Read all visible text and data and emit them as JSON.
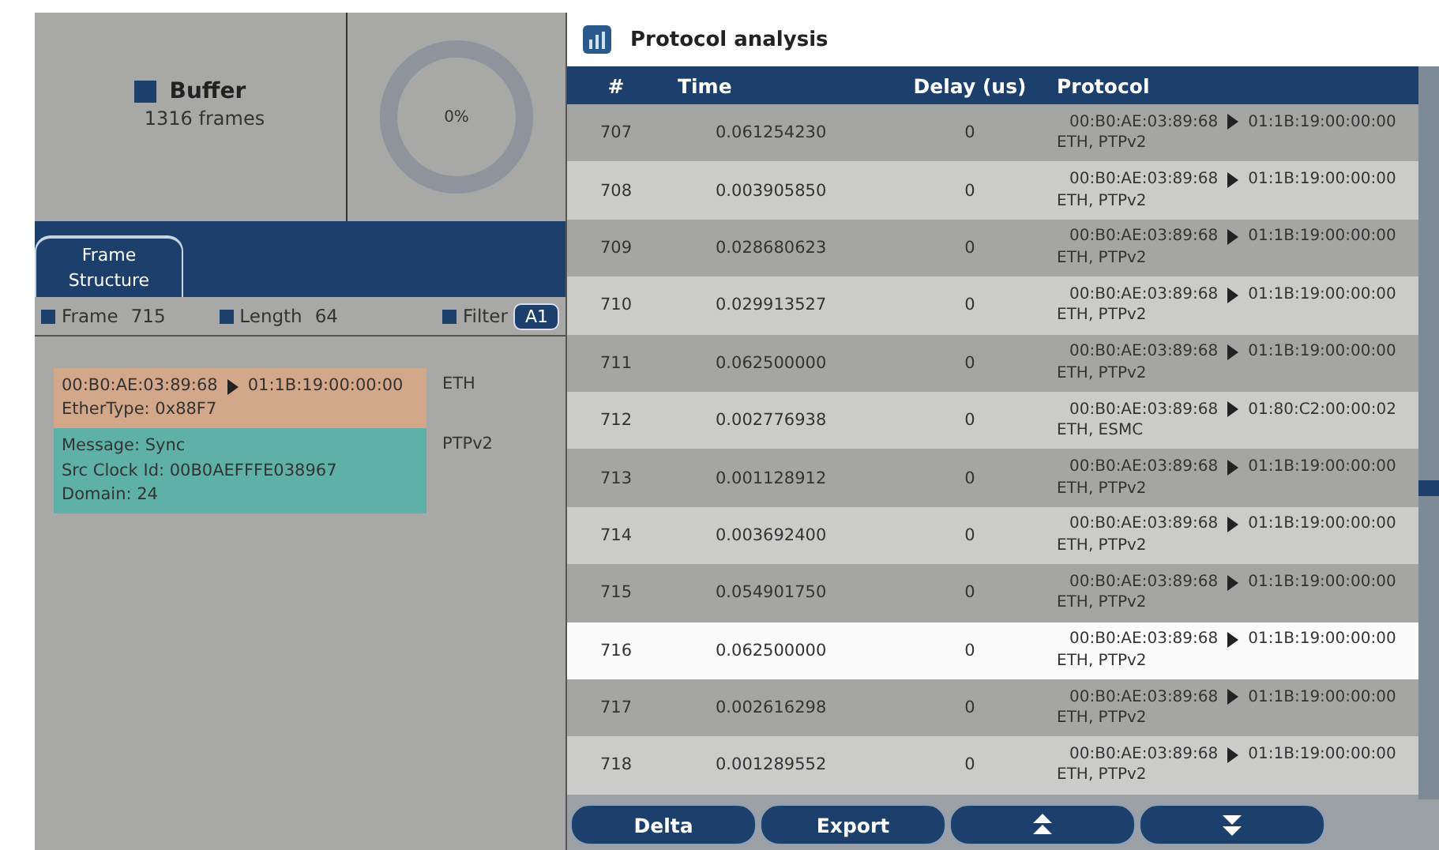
{
  "buffer": {
    "title": "Buffer",
    "frames": "1316 frames",
    "gauge": {
      "label": "0%",
      "level": 0
    }
  },
  "tabs": [
    {
      "label": "Frame Structure",
      "selected": true
    }
  ],
  "info": [
    {
      "label": "Frame",
      "value": "715"
    },
    {
      "label": "Length",
      "value": "64"
    },
    {
      "label": "Filter",
      "badge": "A1"
    }
  ],
  "layers": [
    {
      "color": "#d2a78a",
      "src": "00:B0:AE:03:89:68",
      "dst": "01:1B:19:00:00:00",
      "lines": [
        "EtherType: 0x88F7"
      ],
      "protocol": "ETH"
    },
    {
      "color": "#5fb0a6",
      "lines": [
        "Message: Sync",
        "Src Clock Id: 00B0AEFFFE038967",
        "Domain: 24"
      ],
      "protocol": "PTPv2"
    }
  ],
  "window": {
    "title": "Protocol analysis"
  },
  "table": {
    "columns": [
      "#",
      "Time",
      "Delay (us)",
      "Protocol"
    ],
    "rows": [
      {
        "num": "707",
        "time": "0.061254230",
        "delay": "0",
        "src": "00:B0:AE:03:89:68",
        "dst": "01:1B:19:00:00:00",
        "proto": "ETH, PTPv2",
        "selected": false
      },
      {
        "num": "708",
        "time": "0.003905850",
        "delay": "0",
        "src": "00:B0:AE:03:89:68",
        "dst": "01:1B:19:00:00:00",
        "proto": "ETH, PTPv2",
        "selected": false
      },
      {
        "num": "709",
        "time": "0.028680623",
        "delay": "0",
        "src": "00:B0:AE:03:89:68",
        "dst": "01:1B:19:00:00:00",
        "proto": "ETH, PTPv2",
        "selected": false
      },
      {
        "num": "710",
        "time": "0.029913527",
        "delay": "0",
        "src": "00:B0:AE:03:89:68",
        "dst": "01:1B:19:00:00:00",
        "proto": "ETH, PTPv2",
        "selected": false
      },
      {
        "num": "711",
        "time": "0.062500000",
        "delay": "0",
        "src": "00:B0:AE:03:89:68",
        "dst": "01:1B:19:00:00:00",
        "proto": "ETH, PTPv2",
        "selected": false
      },
      {
        "num": "712",
        "time": "0.002776938",
        "delay": "0",
        "src": "00:B0:AE:03:89:68",
        "dst": "01:80:C2:00:00:02",
        "proto": "ETH, ESMC",
        "selected": false
      },
      {
        "num": "713",
        "time": "0.001128912",
        "delay": "0",
        "src": "00:B0:AE:03:89:68",
        "dst": "01:1B:19:00:00:00",
        "proto": "ETH, PTPv2",
        "selected": false
      },
      {
        "num": "714",
        "time": "0.003692400",
        "delay": "0",
        "src": "00:B0:AE:03:89:68",
        "dst": "01:1B:19:00:00:00",
        "proto": "ETH, PTPv2",
        "selected": false
      },
      {
        "num": "715",
        "time": "0.054901750",
        "delay": "0",
        "src": "00:B0:AE:03:89:68",
        "dst": "01:1B:19:00:00:00",
        "proto": "ETH, PTPv2",
        "selected": false
      },
      {
        "num": "716",
        "time": "0.062500000",
        "delay": "0",
        "src": "00:B0:AE:03:89:68",
        "dst": "01:1B:19:00:00:00",
        "proto": "ETH, PTPv2",
        "selected": true
      },
      {
        "num": "717",
        "time": "0.002616298",
        "delay": "0",
        "src": "00:B0:AE:03:89:68",
        "dst": "01:1B:19:00:00:00",
        "proto": "ETH, PTPv2",
        "selected": false
      },
      {
        "num": "718",
        "time": "0.001289552",
        "delay": "0",
        "src": "00:B0:AE:03:89:68",
        "dst": "01:1B:19:00:00:00",
        "proto": "ETH, PTPv2",
        "selected": false
      }
    ]
  },
  "buttons": [
    {
      "kind": "text",
      "label": "Delta"
    },
    {
      "kind": "text",
      "label": "Export"
    },
    {
      "kind": "up"
    },
    {
      "kind": "down"
    }
  ]
}
